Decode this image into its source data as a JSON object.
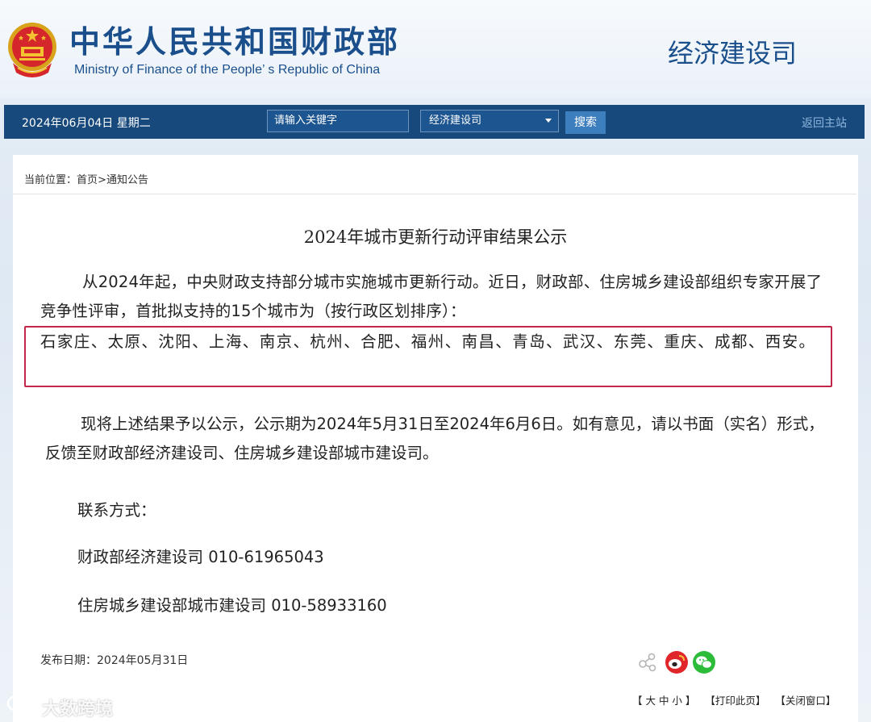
{
  "header": {
    "ministry_cn": "中华人民共和国财政部",
    "ministry_en": "Ministry of Finance of the People’ s Republic of China",
    "dept_title": "经济建设司"
  },
  "nav": {
    "date": "2024年06月04日  星期二",
    "search_placeholder": "请输入关键字",
    "dept_select": "经济建设司",
    "search_button": "搜索",
    "back_home": "返回主站"
  },
  "breadcrumb": {
    "label": "当前位置：",
    "home": "首页",
    "separator": ">",
    "section": "通知公告"
  },
  "article": {
    "title": "2024年城市更新行动评审结果公示",
    "para1": "从2024年起，中央财政支持部分城市实施城市更新行动。近日，财政部、住房城乡建设部组织专家开展了竞争性评审，首批拟支持的15个城市为（按行政区划排序）：",
    "para2_cities": "石家庄、太原、沈阳、上海、南京、杭州、合肥、福州、南昌、青岛、武汉、东莞、重庆、成都、西安。",
    "para3": "现将上述结果予以公示，公示期为2024年5月31日至2024年6月6日。如有意见，请以书面（实名）形式，反馈至财政部经济建设司、住房城乡建设部城市建设司。",
    "contact_label": "联系方式：",
    "contact_1": "财政部经济建设司 010-61965043",
    "contact_2": "住房城乡建设部城市建设司 010-58933160",
    "publish_date": "发布日期：2024年05月31日"
  },
  "footer": {
    "font_size": "【 大 中 小 】",
    "print": "【打印此页】",
    "close": "【关闭窗口】"
  },
  "watermark": {
    "text": "大数跨境"
  },
  "colors": {
    "nav_bg": "#17497d",
    "brand_blue": "#1a4f8c",
    "highlight_border": "#c2274b",
    "weibo": "#e0262a",
    "wechat": "#2dbb3a"
  },
  "icons": [
    "national-emblem-icon",
    "share-icon",
    "weibo-icon",
    "wechat-icon",
    "chevron-down-icon"
  ]
}
